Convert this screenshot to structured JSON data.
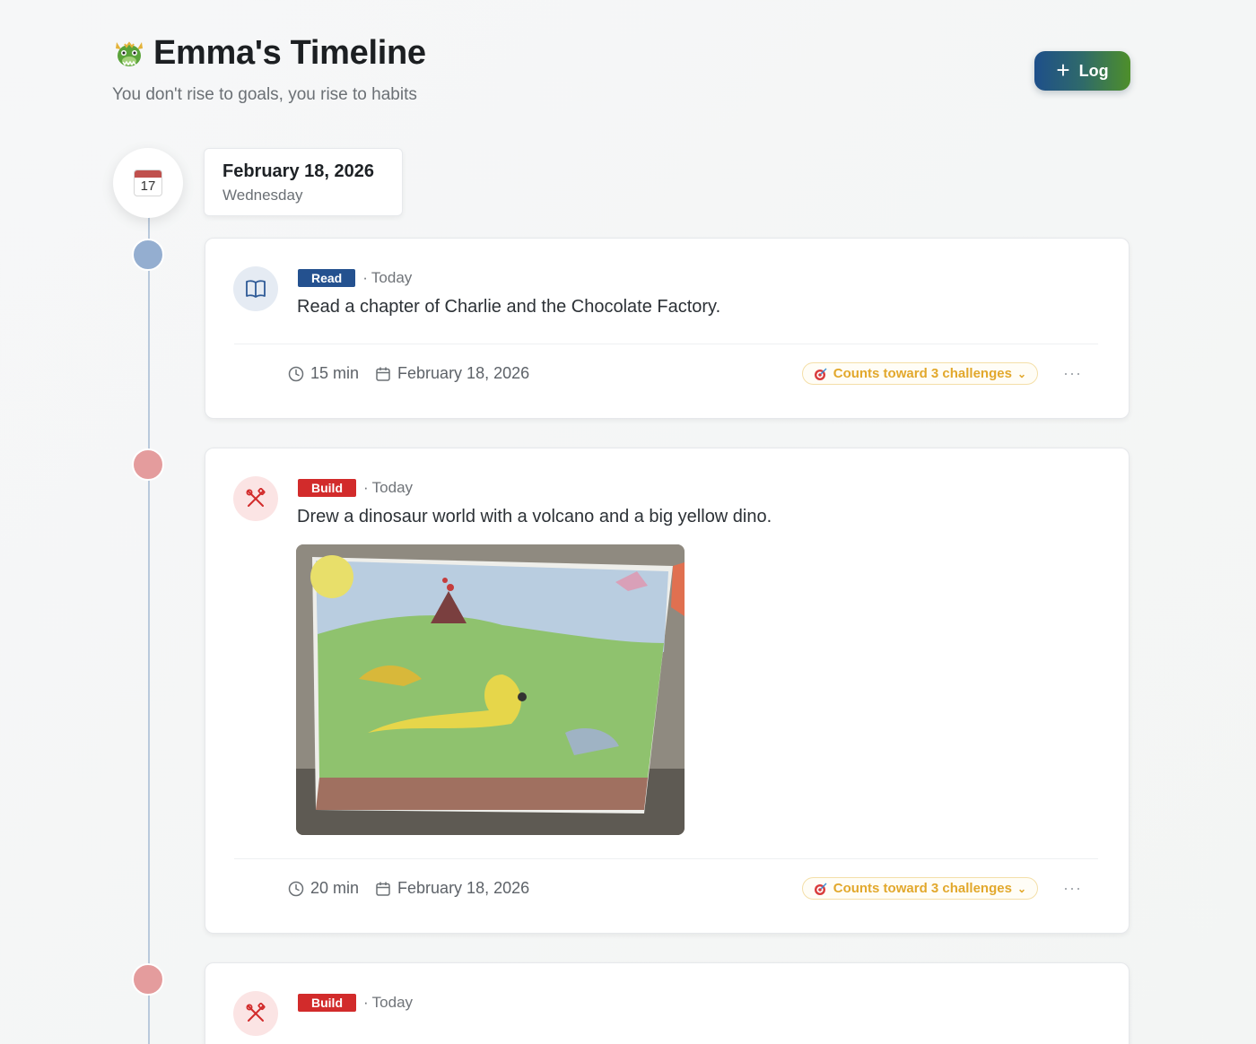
{
  "header": {
    "emoji_icon": "dragon-icon",
    "title": "Emma's Timeline",
    "subtitle": "You don't rise to goals, you rise to habits",
    "log_button": "Log"
  },
  "date_group": {
    "calendar_day": "17",
    "date": "February 18, 2026",
    "weekday": "Wednesday"
  },
  "entries": [
    {
      "category": "Read",
      "category_color": "#24518f",
      "when": "Today",
      "icon": "book-icon",
      "description": "Read a chapter of Charlie and the Chocolate Factory.",
      "duration": "15 min",
      "date": "February 18, 2026",
      "challenges": "Counts toward 3 challenges"
    },
    {
      "category": "Build",
      "category_color": "#d22b2b",
      "when": "Today",
      "icon": "tools-icon",
      "description": "Drew a dinosaur world with a volcano and a big yellow dino.",
      "photo": "dinosaur-drawing-photo",
      "duration": "20 min",
      "date": "February 18, 2026",
      "challenges": "Counts toward 3 challenges"
    },
    {
      "category": "Build",
      "category_color": "#d22b2b",
      "when": "Today",
      "icon": "tools-icon"
    }
  ],
  "more_label": "···"
}
